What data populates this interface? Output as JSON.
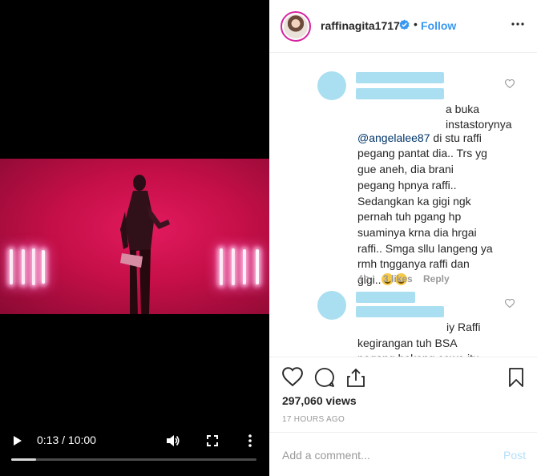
{
  "video": {
    "time_display": "0:13 / 10:00",
    "progress_fraction": 0.1,
    "buffered_fraction": 0.095
  },
  "header": {
    "username": "raffinagita1717",
    "separator": "•",
    "follow_label": "Follow"
  },
  "comments": [
    {
      "text_prefix": "a buka\ninstastorynya\n",
      "mention": "@angelalee87",
      "text_body": " di stu raffi\npegang pantat dia.. Trs yg\ngue aneh, dia brani\npegang hpnya raffi..\nSedangkan ka gigi ngk\npernah tuh pgang hp\nsuaminya krna dia hrgai\nraffi.. Smga sllu langeng ya\nrmh tngganya raffi dan\ngigi..",
      "time": "4h",
      "likes": "3 likes",
      "reply": "Reply"
    },
    {
      "text_prefix": "iy Raffi",
      "text_body": "kegirangan tuh BSA\npegang bokong cewe itu\nt...MR...i....t...d.......t"
    }
  ],
  "actions": {
    "views": "297,060 views",
    "time_ago": "17 HOURS AGO"
  },
  "add_comment": {
    "placeholder": "Add a comment...",
    "post_label": "Post"
  },
  "colors": {
    "accent": "#3897f0",
    "redacted": "#a9dff0",
    "video_stage": "#c50f48"
  }
}
